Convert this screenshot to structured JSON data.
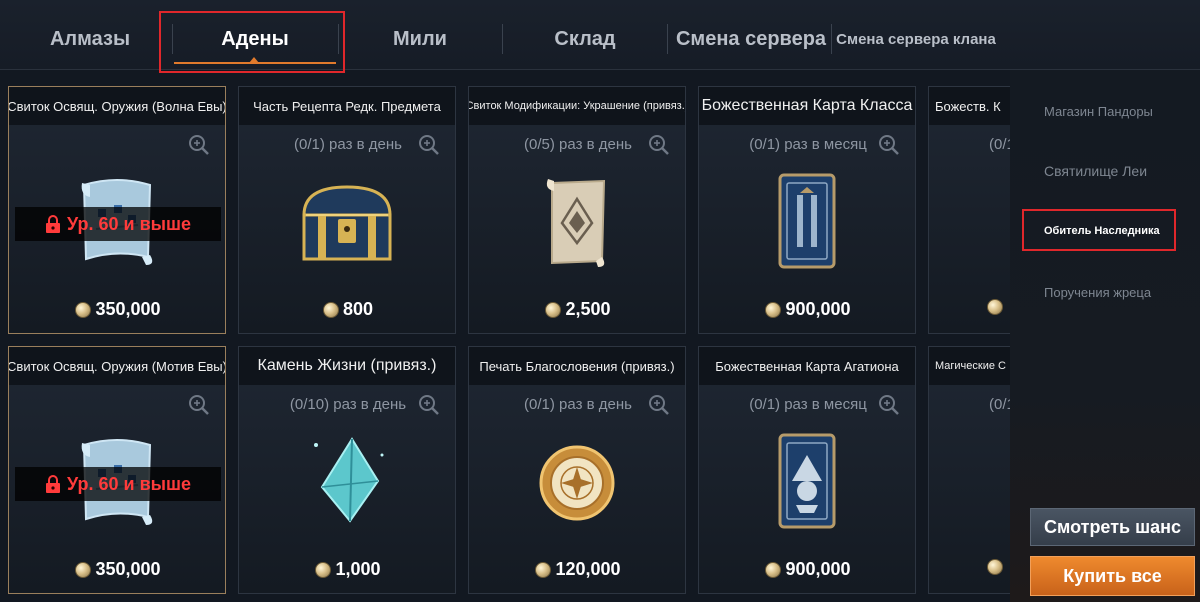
{
  "tabs": [
    {
      "label": "Алмазы"
    },
    {
      "label": "Адены"
    },
    {
      "label": "Мили"
    },
    {
      "label": "Склад"
    },
    {
      "label": "Смена сервера"
    },
    {
      "label": "Смена сервера клана"
    }
  ],
  "active_tab": "Адены",
  "items": [
    {
      "title": "Свиток Освящ. Оружия (Волна Евы)",
      "limit": "",
      "lock": "Ур. 60 и выше",
      "price": "350,000",
      "icon": "scroll-icon"
    },
    {
      "title": "Часть Рецепта Редк. Предмета",
      "limit": "(0/1) раз в день",
      "lock": "",
      "price": "800",
      "icon": "chest-icon"
    },
    {
      "title": "Свиток Модификации: Украшение (привяз.)",
      "limit": "(0/5) раз в день",
      "lock": "",
      "price": "2,500",
      "icon": "parchment-icon"
    },
    {
      "title": "Божественная Карта Класса",
      "limit": "(0/1) раз в месяц",
      "lock": "",
      "price": "900,000",
      "icon": "card-icon"
    },
    {
      "title": "Божеств. К",
      "limit": "(0/1",
      "lock": "",
      "price": "",
      "icon": ""
    },
    {
      "title": "Свиток Освящ. Оружия (Мотив Евы)",
      "limit": "",
      "lock": "Ур. 60 и выше",
      "price": "350,000",
      "icon": "scroll-icon"
    },
    {
      "title": "Камень Жизни (привяз.)",
      "limit": "(0/10) раз в день",
      "lock": "",
      "price": "1,000",
      "icon": "crystal-icon"
    },
    {
      "title": "Печать Благословения (привяз.)",
      "limit": "(0/1) раз в день",
      "lock": "",
      "price": "120,000",
      "icon": "seal-icon"
    },
    {
      "title": "Божественная Карта Агатиона",
      "limit": "(0/1) раз в месяц",
      "lock": "",
      "price": "900,000",
      "icon": "card-icon"
    },
    {
      "title": "Магические С",
      "limit": "(0/1",
      "lock": "",
      "price": "",
      "icon": ""
    }
  ],
  "side_menu": [
    {
      "label": "Магазин Пандоры"
    },
    {
      "label": "Святилище Леи"
    },
    {
      "label": "Обитель Наследника"
    },
    {
      "label": "Поручения жреца"
    }
  ],
  "selected_side": "Обитель Наследника",
  "buttons": {
    "chance": "Смотреть шанс",
    "buy_all": "Купить все"
  },
  "colors": {
    "accent": "#e07a2c",
    "highlight_box": "#e0272b",
    "lock_text": "#ff3b3b"
  }
}
